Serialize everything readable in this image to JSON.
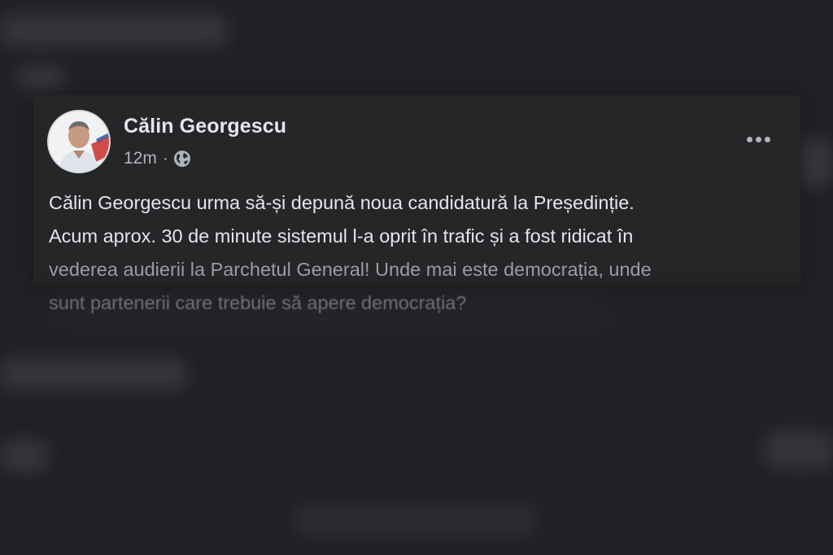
{
  "post": {
    "author_name": "Călin Georgescu",
    "timestamp": "12m",
    "separator": "·",
    "audience_icon": "globe-icon",
    "more_icon": "more-options-icon",
    "text_lines": [
      "Călin Georgescu urma să-și depună noua candidatură la Președinție.",
      "Acum aprox. 30 de minute sistemul l-a oprit în trafic și a fost ridicat în",
      "vederea audierii la Parchetul General! Unde mai este democrația, unde",
      "sunt partenerii care trebuie să apere democrația?"
    ]
  },
  "colors": {
    "background": "#202124",
    "card": "#252628",
    "primary_text": "#e4e6eb",
    "secondary_text": "#b0b3b8"
  }
}
